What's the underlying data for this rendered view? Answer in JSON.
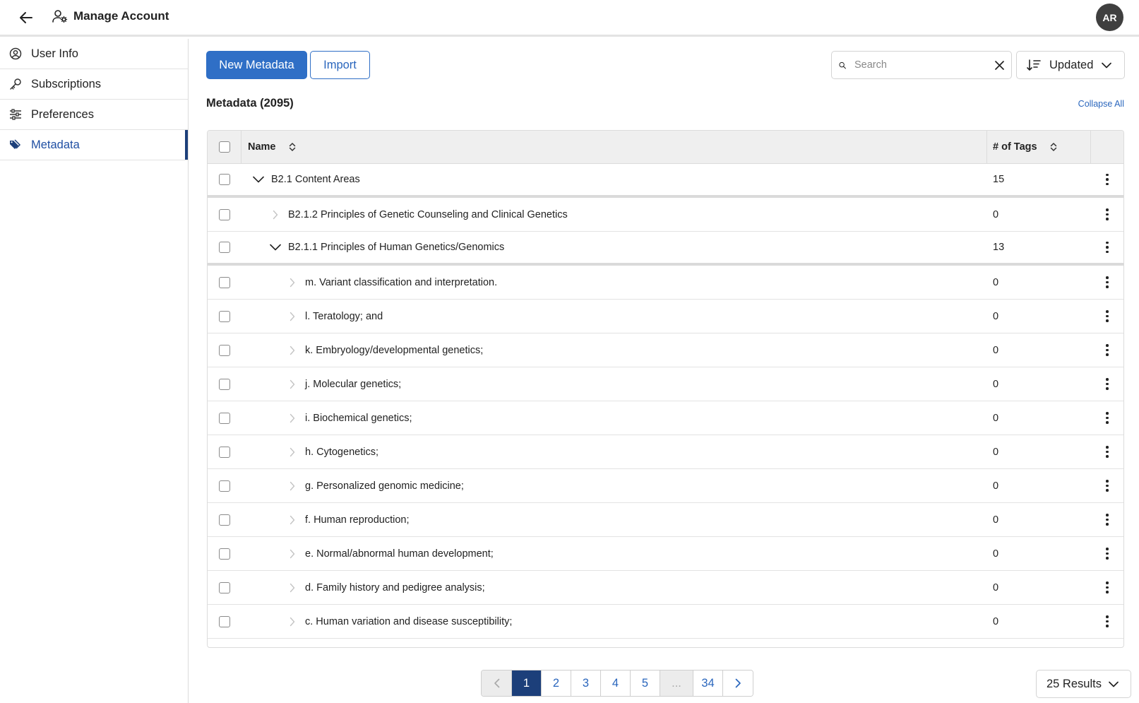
{
  "header": {
    "title": "Manage Account",
    "avatar_initials": "AR"
  },
  "sidebar": {
    "items": [
      {
        "label": "User Info",
        "icon": "user-circle-icon",
        "active": false
      },
      {
        "label": "Subscriptions",
        "icon": "key-icon",
        "active": false
      },
      {
        "label": "Preferences",
        "icon": "sliders-icon",
        "active": false
      },
      {
        "label": "Metadata",
        "icon": "tags-icon",
        "active": true
      }
    ]
  },
  "toolbar": {
    "new_label": "New Metadata",
    "import_label": "Import",
    "search_placeholder": "Search",
    "sort_label": "Updated"
  },
  "section": {
    "title": "Metadata (2095)",
    "collapse_all": "Collapse All"
  },
  "table": {
    "columns": {
      "name": "Name",
      "tags": "# of Tags"
    },
    "rows": [
      {
        "name": "B2.1 Content Areas",
        "tags": "15",
        "level": 0,
        "expanded": true
      },
      {
        "name": "B2.1.2 Principles of Genetic Counseling and Clinical Genetics",
        "tags": "0",
        "level": 1,
        "expanded": false
      },
      {
        "name": "B2.1.1 Principles of Human Genetics/Genomics",
        "tags": "13",
        "level": 1,
        "expanded": true
      },
      {
        "name": "m. Variant classification and interpretation.",
        "tags": "0",
        "level": 2,
        "expanded": false
      },
      {
        "name": "l. Teratology; and",
        "tags": "0",
        "level": 2,
        "expanded": false
      },
      {
        "name": "k. Embryology/developmental genetics;",
        "tags": "0",
        "level": 2,
        "expanded": false
      },
      {
        "name": "j. Molecular genetics;",
        "tags": "0",
        "level": 2,
        "expanded": false
      },
      {
        "name": "i. Biochemical genetics;",
        "tags": "0",
        "level": 2,
        "expanded": false
      },
      {
        "name": "h. Cytogenetics;",
        "tags": "0",
        "level": 2,
        "expanded": false
      },
      {
        "name": "g. Personalized genomic medicine;",
        "tags": "0",
        "level": 2,
        "expanded": false
      },
      {
        "name": "f. Human reproduction;",
        "tags": "0",
        "level": 2,
        "expanded": false
      },
      {
        "name": "e. Normal/abnormal human development;",
        "tags": "0",
        "level": 2,
        "expanded": false
      },
      {
        "name": "d. Family history and pedigree analysis;",
        "tags": "0",
        "level": 2,
        "expanded": false
      },
      {
        "name": "c. Human variation and disease susceptibility;",
        "tags": "0",
        "level": 2,
        "expanded": false
      }
    ]
  },
  "pagination": {
    "pages": [
      "1",
      "2",
      "3",
      "4",
      "5"
    ],
    "ellipsis": "...",
    "last_page": "34",
    "current": "1",
    "results_label": "25 Results"
  }
}
